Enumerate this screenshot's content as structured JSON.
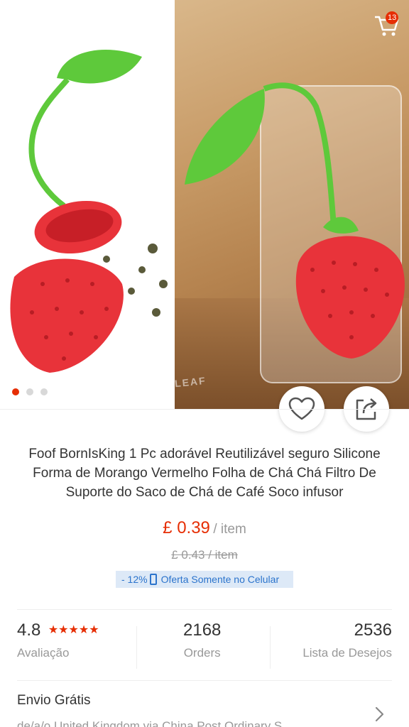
{
  "header": {
    "cart_count": "13"
  },
  "hero": {
    "brand_mark": "LEAF",
    "active_index": 0,
    "dot_count": 3
  },
  "product": {
    "title": "Foof BornIsKing 1 Pc adorável Reutilizável seguro Silicone Forma de Morango Vermelho Folha de Chá Chá Filtro De Suporte do Saco de Chá de Café Soco infusor",
    "price": "£ 0.39",
    "price_unit": "/ item",
    "old_price": "£ 0.43  / item",
    "discount": "- 12%",
    "promo_text": "Oferta Somente no Celular"
  },
  "stats": {
    "rating": "4.8",
    "stars": "★★★★★",
    "rating_label": "Avaliação",
    "orders": "2168",
    "orders_label": "Orders",
    "wishlist": "2536",
    "wishlist_label": "Lista de Desejos"
  },
  "shipping": {
    "title": "Envio Grátis",
    "detail": "de/a/o United Kingdom via China Post Ordinary S..."
  },
  "colors": {
    "accent": "#e62e04",
    "promo_bg": "#dde9f7",
    "promo_text": "#2c74cc"
  },
  "icons": {
    "back": "chevron-left-icon",
    "cart": "cart-icon",
    "wishlist": "heart-icon",
    "share": "share-icon",
    "phone": "phone-icon",
    "more": "chevron-right-icon"
  }
}
